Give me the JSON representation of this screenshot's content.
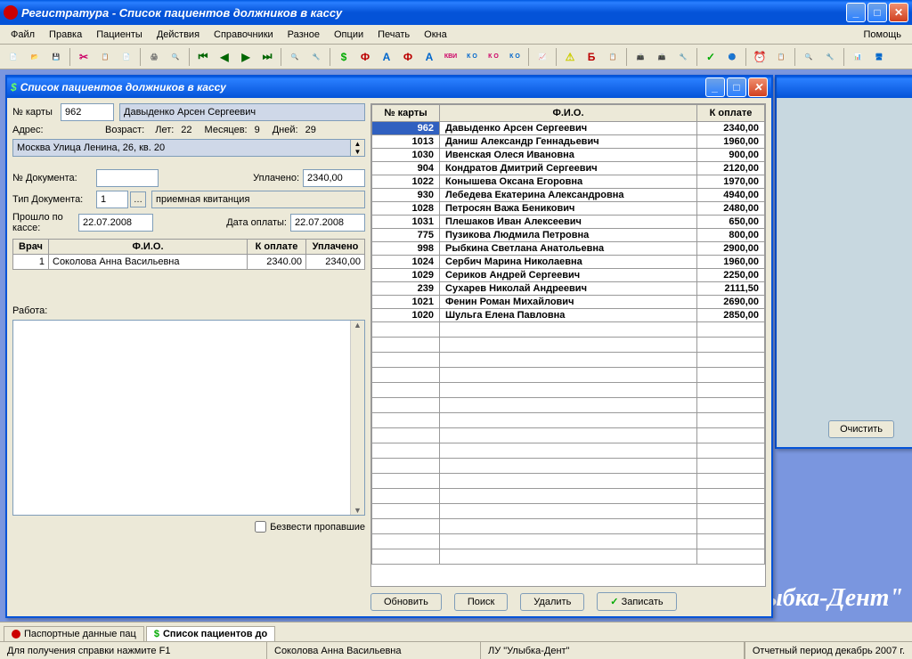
{
  "app": {
    "title": "Регистратура - Список пациентов должников в кассу",
    "brand": "лыбка-Дент\""
  },
  "menubar": {
    "file": "Файл",
    "edit": "Правка",
    "patients": "Пациенты",
    "actions": "Действия",
    "refs": "Справочники",
    "misc": "Разное",
    "options": "Опции",
    "print": "Печать",
    "windows": "Окна",
    "help": "Помощь"
  },
  "child": {
    "title": "Список пациентов должников в кассу"
  },
  "form": {
    "card_label": "№ карты",
    "card_value": "962",
    "fio_value": "Давыденко Арсен Сергеевич",
    "address_label": "Адрес:",
    "address_value": "Москва Улица Ленина, 26, кв. 20",
    "age_label": "Возраст:",
    "years_label": "Лет:",
    "years_value": "22",
    "months_label": "Месяцев:",
    "months_value": "9",
    "days_label": "Дней:",
    "days_value": "29",
    "doc_num_label": "№ Документа:",
    "doc_num_value": "",
    "paid_label": "Уплачено:",
    "paid_value": "2340,00",
    "doc_type_label": "Тип Документа:",
    "doc_type_num": "1",
    "doc_type_name": "приемная квитанция",
    "elapsed_label": "Прошло по кассе:",
    "elapsed_value": "22.07.2008",
    "pay_date_label": "Дата оплаты:",
    "pay_date_value": "22.07.2008",
    "work_label": "Работа:",
    "checkbox_label": "Безвести пропавшие"
  },
  "doctor_table": {
    "headers": {
      "doctor": "Врач",
      "fio": "Ф.И.О.",
      "topay": "К оплате",
      "paid": "Уплачено"
    },
    "row": {
      "n": "1",
      "fio": "Соколова Анна Васильевна",
      "topay": "2340.00",
      "paid": "2340,00"
    }
  },
  "patient_table": {
    "headers": {
      "card": "№ карты",
      "fio": "Ф.И.О.",
      "pay": "К оплате"
    },
    "rows": [
      {
        "card": "962",
        "fio": "Давыденко Арсен Сергеевич",
        "pay": "2340,00",
        "selected": true
      },
      {
        "card": "1013",
        "fio": "Даниш Александр Геннадьевич",
        "pay": "1960,00"
      },
      {
        "card": "1030",
        "fio": "Ивенская Олеся Ивановна",
        "pay": "900,00"
      },
      {
        "card": "904",
        "fio": "Кондратов Дмитрий Сергеевич",
        "pay": "2120,00"
      },
      {
        "card": "1022",
        "fio": "Конышева Оксана Егоровна",
        "pay": "1970,00"
      },
      {
        "card": "930",
        "fio": "Лебедева Екатерина Александровна",
        "pay": "4940,00"
      },
      {
        "card": "1028",
        "fio": "Петросян Важа Беникович",
        "pay": "2480,00"
      },
      {
        "card": "1031",
        "fio": "Плешаков Иван Алексеевич",
        "pay": "650,00"
      },
      {
        "card": "775",
        "fio": "Пузикова Людмила Петровна",
        "pay": "800,00"
      },
      {
        "card": "998",
        "fio": "Рыбкина Светлана Анатольевна",
        "pay": "2900,00"
      },
      {
        "card": "1024",
        "fio": "Сербич Марина Николаевна",
        "pay": "1960,00"
      },
      {
        "card": "1029",
        "fio": "Сериков Андрей Сергеевич",
        "pay": "2250,00"
      },
      {
        "card": "239",
        "fio": "Сухарев Николай Андреевич",
        "pay": "2111,50"
      },
      {
        "card": "1021",
        "fio": "Фенин Роман Михайлович",
        "pay": "2690,00"
      },
      {
        "card": "1020",
        "fio": "Шульга Елена Павловна",
        "pay": "2850,00"
      }
    ]
  },
  "actions": {
    "update": "Обновить",
    "search": "Поиск",
    "delete": "Удалить",
    "save": "Записать",
    "clear": "Очистить"
  },
  "tabs": {
    "passport": "Паспортные данные пац",
    "debtors": "Список пациентов до"
  },
  "status": {
    "help": "Для получения справки нажмите F1",
    "doctor": "Соколова Анна Васильевна",
    "clinic": "ЛУ \"Улыбка-Дент\"",
    "period": "Отчетный период декабрь 2007 г."
  },
  "toolbar_icons": [
    "📄",
    "📂",
    "💾",
    "",
    "✂",
    "📋",
    "📄",
    "",
    "🖨",
    "🔍",
    "",
    "⏮",
    "◀",
    "▶",
    "⏭",
    "",
    "🔍",
    "🔧",
    "",
    "$",
    "Ф",
    "А",
    "Ф",
    "А",
    "КВИ",
    "К О",
    "К О",
    "К О",
    "",
    "📈",
    "",
    "⚠",
    "Б",
    "📋",
    "",
    "📠",
    "📠",
    "🔧",
    "",
    "✓",
    "🔵",
    "",
    "⏰",
    "📋",
    "",
    "🔍",
    "🔧",
    "",
    "📊",
    "🖥"
  ]
}
